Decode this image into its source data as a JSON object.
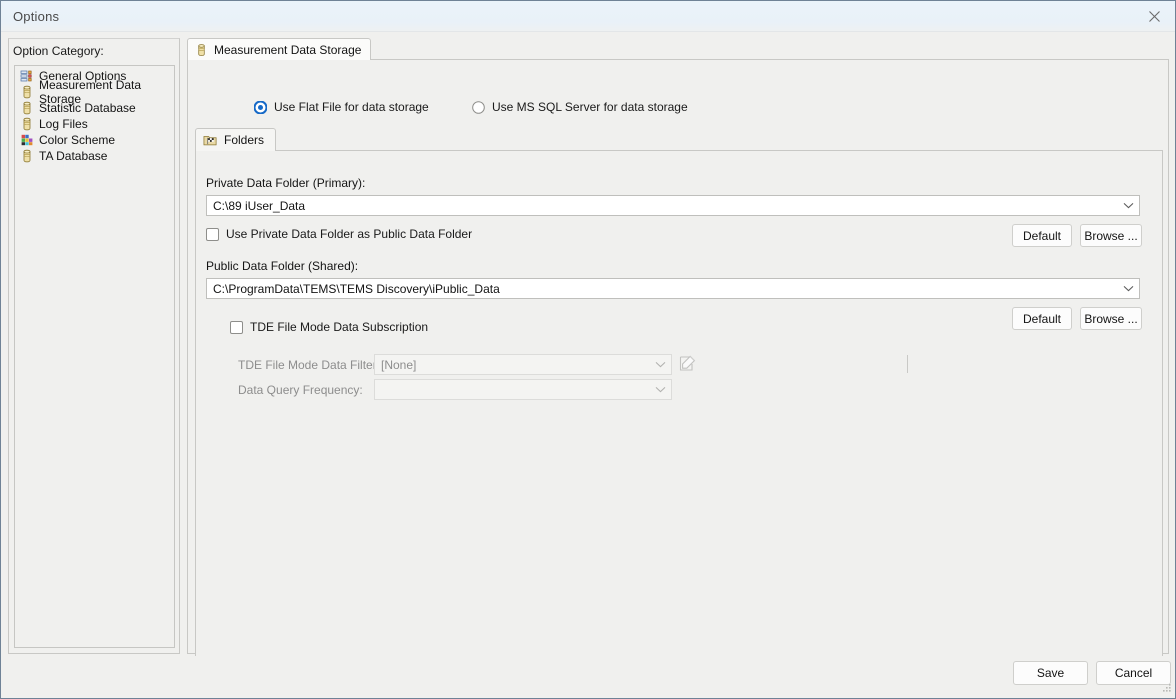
{
  "window": {
    "title": "Options",
    "close_icon": "close-icon"
  },
  "sidebar": {
    "label": "Option Category:",
    "items": [
      {
        "label": "General Options",
        "icon": "list-settings-icon",
        "selected": false
      },
      {
        "label": "Measurement Data Storage",
        "icon": "database-icon",
        "selected": false
      },
      {
        "label": "Statistic Database",
        "icon": "database-icon",
        "selected": false
      },
      {
        "label": "Log Files",
        "icon": "database-icon",
        "selected": false
      },
      {
        "label": "Color Scheme",
        "icon": "color-palette-icon",
        "selected": false
      },
      {
        "label": "TA Database",
        "icon": "database-icon",
        "selected": false
      }
    ]
  },
  "main": {
    "outer_tab": {
      "label": "Measurement Data Storage",
      "icon": "database-icon"
    },
    "storage_mode": {
      "options": [
        {
          "label": "Use Flat File for data storage",
          "selected": true
        },
        {
          "label": "Use MS SQL Server for data storage",
          "selected": false
        }
      ]
    },
    "inner_tab": {
      "label": "Folders",
      "icon": "folder-flag-icon"
    },
    "private_folder": {
      "label": "Private Data Folder (Primary):",
      "value": "C:\\89 iUser_Data",
      "default_label": "Default",
      "browse_label": "Browse ..."
    },
    "use_private_as_public": {
      "label": "Use Private Data Folder as Public Data Folder",
      "checked": false
    },
    "public_folder": {
      "label": "Public Data Folder (Shared):",
      "value": "C:\\ProgramData\\TEMS\\TEMS Discovery\\iPublic_Data",
      "default_label": "Default",
      "browse_label": "Browse ..."
    },
    "tde_subscription": {
      "label": "TDE File Mode Data Subscription",
      "checked": false
    },
    "tde_filter": {
      "label": "TDE File Mode Data Filter:",
      "value": "[None]",
      "edit_icon": "edit-pencil-icon",
      "disabled": true
    },
    "query_frequency": {
      "label": "Data Query Frequency:",
      "value": "",
      "disabled": true
    }
  },
  "footer": {
    "save_label": "Save",
    "cancel_label": "Cancel",
    "grip_icon": "resize-grip-icon"
  },
  "colors": {
    "titlebar": "#eaf3fa",
    "dialog_bg": "#f0f0ee",
    "accent_radio": "#1569c7",
    "border": "#c8c8c5",
    "disabled_text": "#8d8d8d"
  }
}
